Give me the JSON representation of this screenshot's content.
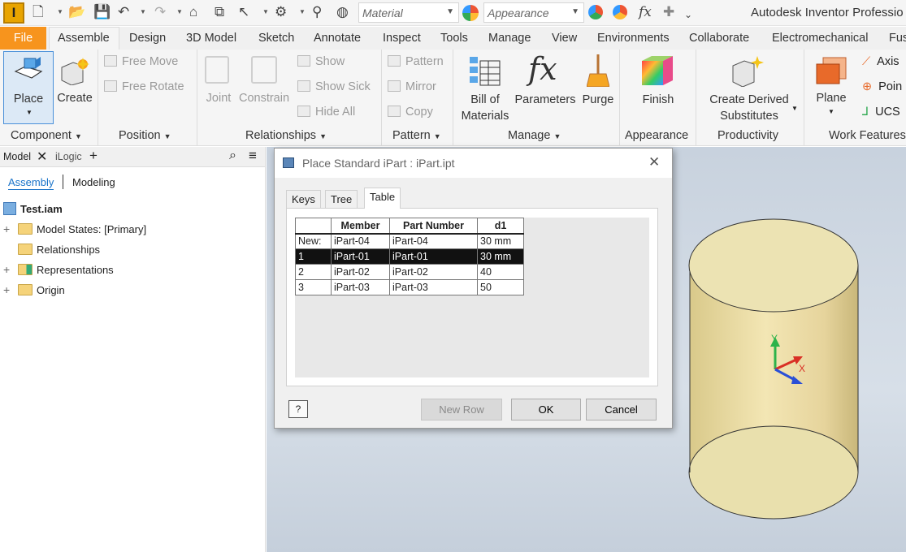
{
  "app": {
    "title": "Autodesk Inventor Professio"
  },
  "qat": {
    "material": "Material",
    "appearance": "Appearance",
    "fx": "fx"
  },
  "tabs": [
    "File",
    "Assemble",
    "Design",
    "3D Model",
    "Sketch",
    "Annotate",
    "Inspect",
    "Tools",
    "Manage",
    "View",
    "Environments",
    "Collaborate",
    "Electromechanical",
    "Fus"
  ],
  "ribbon": {
    "place": "Place",
    "create": "Create",
    "free_move": "Free Move",
    "free_rotate": "Free Rotate",
    "joint": "Joint",
    "constrain": "Constrain",
    "show": "Show",
    "show_sick": "Show Sick",
    "hide_all": "Hide All",
    "pattern": "Pattern",
    "mirror": "Mirror",
    "copy": "Copy",
    "bom_line1": "Bill of",
    "bom_line2": "Materials",
    "parameters": "Parameters",
    "purge": "Purge",
    "finish": "Finish",
    "derived_line1": "Create Derived",
    "derived_line2": "Substitutes",
    "plane": "Plane",
    "axis": "Axis",
    "point": "Poin",
    "ucs": "UCS",
    "groups": {
      "component": "Component",
      "position": "Position",
      "relationships": "Relationships",
      "pattern": "Pattern",
      "manage": "Manage",
      "appearance": "Appearance",
      "productivity": "Productivity",
      "work_features": "Work Features"
    }
  },
  "browser": {
    "tab_model": "Model",
    "tab_ilogic": "iLogic",
    "mode_assembly": "Assembly",
    "mode_modeling": "Modeling",
    "root": "Test.iam",
    "items": [
      "Model States: [Primary]",
      "Relationships",
      "Representations",
      "Origin"
    ]
  },
  "dialog": {
    "title": "Place Standard iPart : iPart.ipt",
    "tabs": [
      "Keys",
      "Tree",
      "Table"
    ],
    "columns": [
      "Member",
      "Part Number",
      "d1"
    ],
    "rows": [
      {
        "key": "New:",
        "member": "iPart-04",
        "part": "iPart-04",
        "d1": "30 mm"
      },
      {
        "key": "1",
        "member": "iPart-01",
        "part": "iPart-01",
        "d1": "30 mm"
      },
      {
        "key": "2",
        "member": "iPart-02",
        "part": "iPart-02",
        "d1": "40"
      },
      {
        "key": "3",
        "member": "iPart-03",
        "part": "iPart-03",
        "d1": "50"
      }
    ],
    "new_row": "New Row",
    "ok": "OK",
    "cancel": "Cancel"
  },
  "triad": {
    "x": "X",
    "y": "Y"
  }
}
